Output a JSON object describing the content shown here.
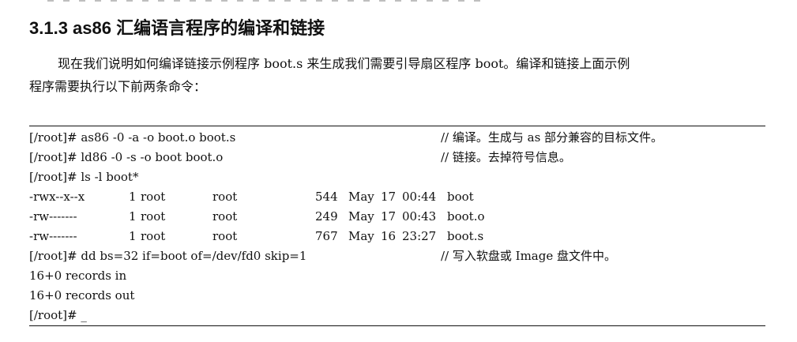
{
  "heading": "3.1.3 as86 汇编语言程序的编译和链接",
  "paragraph": {
    "line1": "现在我们说明如何编译链接示例程序 boot.s 来生成我们需要引导扇区程序 boot。编译和链接上面示例",
    "line2": "程序需要执行以下前两条命令："
  },
  "code": {
    "commands": [
      {
        "text": "[/root]# as86 -0 -a -o boot.o boot.s",
        "comment": "// 编译。生成与 as 部分兼容的目标文件。"
      },
      {
        "text": "[/root]# ld86 -0 -s -o boot boot.o",
        "comment": "// 链接。去掉符号信息。"
      },
      {
        "text": "[/root]# ls -l boot*",
        "comment": ""
      }
    ],
    "listing": [
      {
        "perm": "-rwx--x--x",
        "links": "1",
        "owner": "root",
        "group": "root",
        "size": "544",
        "month": "May",
        "day": "17",
        "time": "00:44",
        "name": "boot"
      },
      {
        "perm": "-rw-------",
        "links": "1",
        "owner": "root",
        "group": "root",
        "size": "249",
        "month": "May",
        "day": "17",
        "time": "00:43",
        "name": "boot.o"
      },
      {
        "perm": "-rw-------",
        "links": "1",
        "owner": "root",
        "group": "root",
        "size": "767",
        "month": "May",
        "day": "16",
        "time": "23:27",
        "name": "boot.s"
      }
    ],
    "dd": {
      "text": "[/root]# dd bs=32 if=boot of=/dev/fd0 skip=1",
      "comment": "// 写入软盘或 Image 盘文件中。"
    },
    "records_in": "16+0 records in",
    "records_out": "16+0 records out",
    "prompt": "[/root]# _"
  }
}
